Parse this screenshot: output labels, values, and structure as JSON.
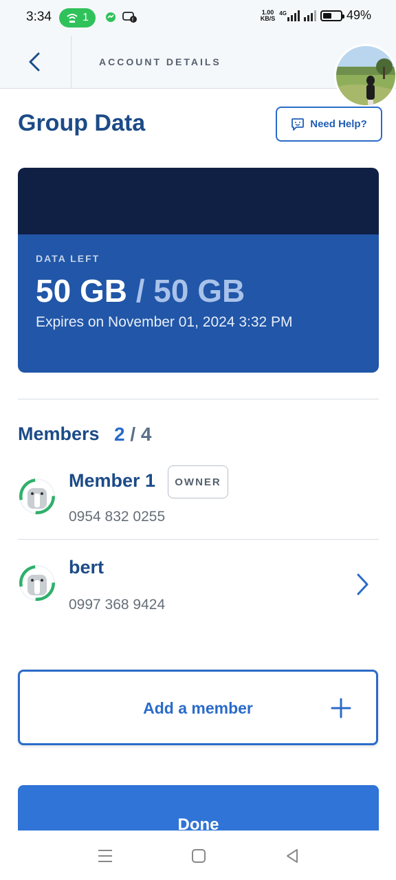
{
  "status_bar": {
    "time": "3:34",
    "hotspot_count": "1",
    "speed_value": "1.00",
    "speed_unit": "KB/S",
    "network": "4G",
    "battery": "49%",
    "battery_level": 0.49
  },
  "header": {
    "title": "ACCOUNT DETAILS"
  },
  "page": {
    "title": "Group Data",
    "help_label": "Need Help?"
  },
  "data_card": {
    "label": "DATA LEFT",
    "remaining": "50 GB",
    "separator": "/",
    "total": "50 GB",
    "expires": "Expires on November 01, 2024 3:32 PM"
  },
  "members": {
    "heading": "Members",
    "current": "2",
    "separator": "/",
    "max": "4",
    "list": [
      {
        "name": "Member 1",
        "badge": "OWNER",
        "phone": "0954 832 0255"
      },
      {
        "name": "bert",
        "phone": "0997 368 9424"
      }
    ]
  },
  "actions": {
    "add_member": "Add a member",
    "done": "Done"
  },
  "colors": {
    "primary": "#2a6bc9",
    "dark_navy": "#102045",
    "card_blue": "#2156a8",
    "title_navy": "#1c4b87"
  }
}
